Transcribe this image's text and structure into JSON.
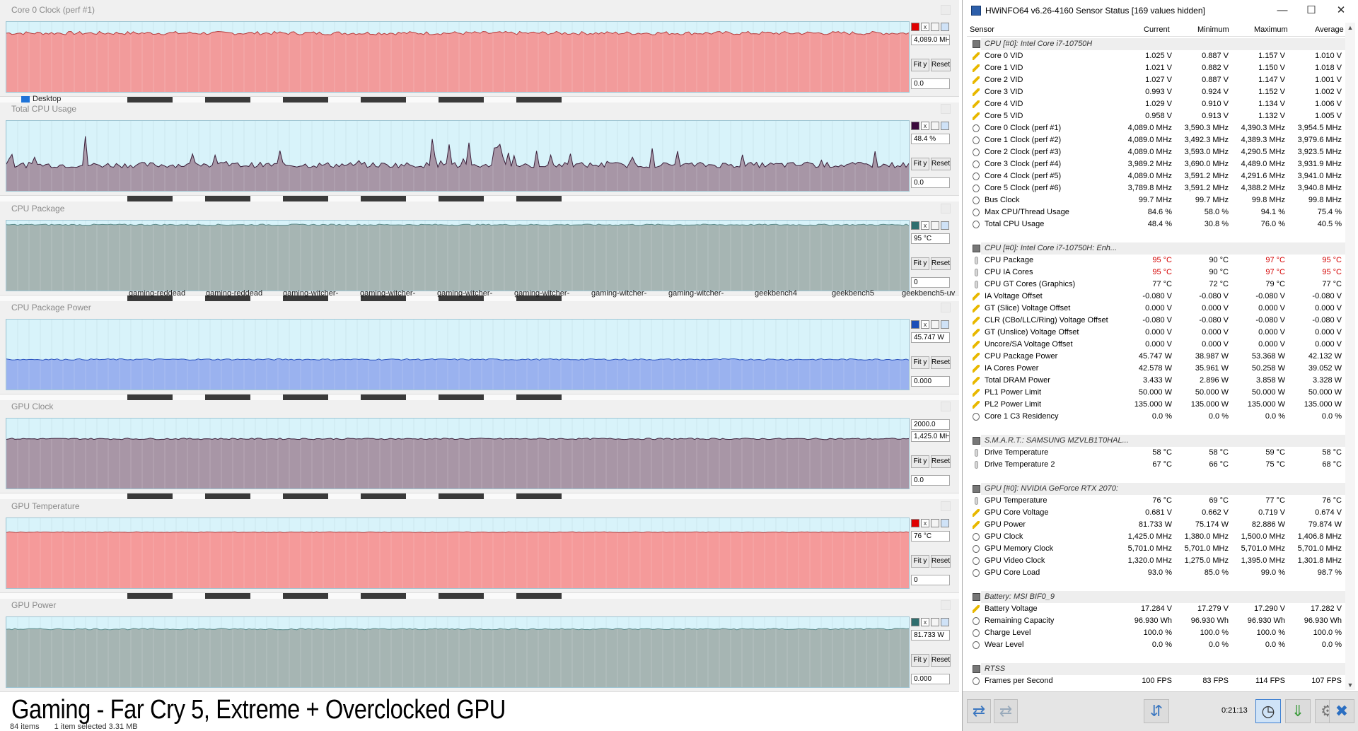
{
  "graphs": [
    {
      "title": "Core 0 Clock (perf #1)",
      "value": "4,089.0 MH:",
      "min": "0.0",
      "fit": "Fit y",
      "reset": "Reset",
      "color": "#f29b9b",
      "line": "#b63c3c",
      "level": 0.84,
      "noise": 0.025,
      "swatch": "#e00000"
    },
    {
      "title": "Total CPU Usage",
      "value": "48.4 %",
      "min": "0.0",
      "fit": "Fit y",
      "reset": "Reset",
      "color": "#a796a6",
      "line": "#3b1f3a",
      "level": 0.37,
      "noise": 0.04,
      "swatch": "#3b0a3b",
      "spiky": true
    },
    {
      "title": "CPU Package",
      "value": "95 °C",
      "min": "0",
      "fit": "Fit y",
      "reset": "Reset",
      "color": "#a6b5b3",
      "line": "#5c8c8c",
      "level": 0.94,
      "noise": 0.01,
      "swatch": "#2f6e6e"
    },
    {
      "title": "CPU Package Power",
      "value": "45.747 W",
      "min": "0.000",
      "fit": "Fit y",
      "reset": "Reset",
      "color": "#9ab2ef",
      "line": "#2d55c0",
      "level": 0.43,
      "noise": 0.01,
      "swatch": "#1d4fb8"
    },
    {
      "title": "GPU Clock",
      "value": "1,425.0 MH:",
      "max": "2000.0",
      "min": "0.0",
      "fit": "Fit y",
      "reset": "Reset",
      "color": "#a896a6",
      "line": "#3b1f3a",
      "level": 0.71,
      "noise": 0.01,
      "swatch": null
    },
    {
      "title": "GPU Temperature",
      "value": "76 °C",
      "min": "0",
      "fit": "Fit y",
      "reset": "Reset",
      "color": "#f59a9a",
      "line": "#b63c3c",
      "level": 0.8,
      "noise": 0.005,
      "swatch": "#e00000"
    },
    {
      "title": "GPU Power",
      "value": "81.733 W",
      "min": "0.000",
      "fit": "Fit y",
      "reset": "Reset",
      "color": "#a6b5b3",
      "line": "#5c8c8c",
      "level": 0.83,
      "noise": 0.01,
      "swatch": "#2f6e6e"
    }
  ],
  "desktop_label": "Desktop",
  "strip_labels": [
    "gaming-reddead",
    "gaming-reddead",
    "gaming-witcher-",
    "gaming-witcher-",
    "gaming-witcher-",
    "gaming-witcher-",
    "gaming-witcher-",
    "gaming-witcher-",
    "geekbench4",
    "geekbench5",
    "geekbench5-uv"
  ],
  "caption": "Gaming -  Far Cry 5, Extreme + Overclocked GPU",
  "statusbar": {
    "items": "84 items",
    "selected": "1 item selected  3.31 MB"
  },
  "hwinfo": {
    "title": "HWiNFO64 v6.26-4160 Sensor Status [169 values hidden]",
    "columns": [
      "Sensor",
      "Current",
      "Minimum",
      "Maximum",
      "Average"
    ],
    "timer": "0:21:13",
    "rows": [
      {
        "t": "grp",
        "n": "CPU [#0]: Intel Core i7-10750H"
      },
      {
        "t": "volt",
        "n": "Core 0 VID",
        "v": [
          "1.025 V",
          "0.887 V",
          "1.157 V",
          "1.010 V"
        ]
      },
      {
        "t": "volt",
        "n": "Core 1 VID",
        "v": [
          "1.021 V",
          "0.882 V",
          "1.150 V",
          "1.018 V"
        ]
      },
      {
        "t": "volt",
        "n": "Core 2 VID",
        "v": [
          "1.027 V",
          "0.887 V",
          "1.147 V",
          "1.001 V"
        ]
      },
      {
        "t": "volt",
        "n": "Core 3 VID",
        "v": [
          "0.993 V",
          "0.924 V",
          "1.152 V",
          "1.002 V"
        ]
      },
      {
        "t": "volt",
        "n": "Core 4 VID",
        "v": [
          "1.029 V",
          "0.910 V",
          "1.134 V",
          "1.006 V"
        ]
      },
      {
        "t": "volt",
        "n": "Core 5 VID",
        "v": [
          "0.958 V",
          "0.913 V",
          "1.132 V",
          "1.005 V"
        ]
      },
      {
        "t": "clock",
        "n": "Core 0 Clock (perf #1)",
        "v": [
          "4,089.0 MHz",
          "3,590.3 MHz",
          "4,390.3 MHz",
          "3,954.5 MHz"
        ]
      },
      {
        "t": "clock",
        "n": "Core 1 Clock (perf #2)",
        "v": [
          "4,089.0 MHz",
          "3,492.3 MHz",
          "4,389.3 MHz",
          "3,979.6 MHz"
        ]
      },
      {
        "t": "clock",
        "n": "Core 2 Clock (perf #3)",
        "v": [
          "4,089.0 MHz",
          "3,593.0 MHz",
          "4,290.5 MHz",
          "3,923.5 MHz"
        ]
      },
      {
        "t": "clock",
        "n": "Core 3 Clock (perf #4)",
        "v": [
          "3,989.2 MHz",
          "3,690.0 MHz",
          "4,489.0 MHz",
          "3,931.9 MHz"
        ]
      },
      {
        "t": "clock",
        "n": "Core 4 Clock (perf #5)",
        "v": [
          "4,089.0 MHz",
          "3,591.2 MHz",
          "4,291.6 MHz",
          "3,941.0 MHz"
        ]
      },
      {
        "t": "clock",
        "n": "Core 5 Clock (perf #6)",
        "v": [
          "3,789.8 MHz",
          "3,591.2 MHz",
          "4,388.2 MHz",
          "3,940.8 MHz"
        ]
      },
      {
        "t": "clock",
        "n": "Bus Clock",
        "v": [
          "99.7 MHz",
          "99.7 MHz",
          "99.8 MHz",
          "99.8 MHz"
        ]
      },
      {
        "t": "clock",
        "n": "Max CPU/Thread Usage",
        "v": [
          "84.6 %",
          "58.0 %",
          "94.1 %",
          "75.4 %"
        ]
      },
      {
        "t": "clock",
        "n": "Total CPU Usage",
        "v": [
          "48.4 %",
          "30.8 %",
          "76.0 %",
          "40.5 %"
        ]
      },
      {
        "t": "blank"
      },
      {
        "t": "grp",
        "n": "CPU [#0]: Intel Core i7-10750H: Enh..."
      },
      {
        "t": "temp",
        "n": "CPU Package",
        "v": [
          "95 °C",
          "90 °C",
          "97 °C",
          "95 °C"
        ],
        "red": [
          0,
          2,
          3
        ]
      },
      {
        "t": "temp",
        "n": "CPU IA Cores",
        "v": [
          "95 °C",
          "90 °C",
          "97 °C",
          "95 °C"
        ],
        "red": [
          0,
          2,
          3
        ]
      },
      {
        "t": "temp",
        "n": "CPU GT Cores (Graphics)",
        "v": [
          "77 °C",
          "72 °C",
          "79 °C",
          "77 °C"
        ]
      },
      {
        "t": "volt",
        "n": "IA Voltage Offset",
        "v": [
          "-0.080 V",
          "-0.080 V",
          "-0.080 V",
          "-0.080 V"
        ]
      },
      {
        "t": "volt",
        "n": "GT (Slice) Voltage Offset",
        "v": [
          "0.000 V",
          "0.000 V",
          "0.000 V",
          "0.000 V"
        ]
      },
      {
        "t": "volt",
        "n": "CLR (CBo/LLC/Ring) Voltage Offset",
        "v": [
          "-0.080 V",
          "-0.080 V",
          "-0.080 V",
          "-0.080 V"
        ]
      },
      {
        "t": "volt",
        "n": "GT (Unslice) Voltage Offset",
        "v": [
          "0.000 V",
          "0.000 V",
          "0.000 V",
          "0.000 V"
        ]
      },
      {
        "t": "volt",
        "n": "Uncore/SA Voltage Offset",
        "v": [
          "0.000 V",
          "0.000 V",
          "0.000 V",
          "0.000 V"
        ]
      },
      {
        "t": "volt",
        "n": "CPU Package Power",
        "v": [
          "45.747 W",
          "38.987 W",
          "53.368 W",
          "42.132 W"
        ]
      },
      {
        "t": "volt",
        "n": "IA Cores Power",
        "v": [
          "42.578 W",
          "35.961 W",
          "50.258 W",
          "39.052 W"
        ]
      },
      {
        "t": "volt",
        "n": "Total DRAM Power",
        "v": [
          "3.433 W",
          "2.896 W",
          "3.858 W",
          "3.328 W"
        ]
      },
      {
        "t": "volt",
        "n": "PL1 Power Limit",
        "v": [
          "50.000 W",
          "50.000 W",
          "50.000 W",
          "50.000 W"
        ]
      },
      {
        "t": "volt",
        "n": "PL2 Power Limit",
        "v": [
          "135.000 W",
          "135.000 W",
          "135.000 W",
          "135.000 W"
        ]
      },
      {
        "t": "clock",
        "n": "Core 1 C3 Residency",
        "v": [
          "0.0 %",
          "0.0 %",
          "0.0 %",
          "0.0 %"
        ]
      },
      {
        "t": "blank"
      },
      {
        "t": "grp",
        "n": "S.M.A.R.T.: SAMSUNG MZVLB1T0HAL..."
      },
      {
        "t": "temp",
        "n": "Drive Temperature",
        "v": [
          "58 °C",
          "58 °C",
          "59 °C",
          "58 °C"
        ]
      },
      {
        "t": "temp",
        "n": "Drive Temperature 2",
        "v": [
          "67 °C",
          "66 °C",
          "75 °C",
          "68 °C"
        ]
      },
      {
        "t": "blank"
      },
      {
        "t": "grp",
        "n": "GPU [#0]: NVIDIA GeForce RTX 2070:"
      },
      {
        "t": "temp",
        "n": "GPU Temperature",
        "v": [
          "76 °C",
          "69 °C",
          "77 °C",
          "76 °C"
        ]
      },
      {
        "t": "volt",
        "n": "GPU Core Voltage",
        "v": [
          "0.681 V",
          "0.662 V",
          "0.719 V",
          "0.674 V"
        ]
      },
      {
        "t": "volt",
        "n": "GPU Power",
        "v": [
          "81.733 W",
          "75.174 W",
          "82.886 W",
          "79.874 W"
        ]
      },
      {
        "t": "clock",
        "n": "GPU Clock",
        "v": [
          "1,425.0 MHz",
          "1,380.0 MHz",
          "1,500.0 MHz",
          "1,406.8 MHz"
        ]
      },
      {
        "t": "clock",
        "n": "GPU Memory Clock",
        "v": [
          "5,701.0 MHz",
          "5,701.0 MHz",
          "5,701.0 MHz",
          "5,701.0 MHz"
        ]
      },
      {
        "t": "clock",
        "n": "GPU Video Clock",
        "v": [
          "1,320.0 MHz",
          "1,275.0 MHz",
          "1,395.0 MHz",
          "1,301.8 MHz"
        ]
      },
      {
        "t": "clock",
        "n": "GPU Core Load",
        "v": [
          "93.0 %",
          "85.0 %",
          "99.0 %",
          "98.7 %"
        ]
      },
      {
        "t": "blank"
      },
      {
        "t": "grp",
        "n": "Battery: MSI BIF0_9"
      },
      {
        "t": "volt",
        "n": "Battery Voltage",
        "v": [
          "17.284 V",
          "17.279 V",
          "17.290 V",
          "17.282 V"
        ]
      },
      {
        "t": "clock",
        "n": "Remaining Capacity",
        "v": [
          "96.930 Wh",
          "96.930 Wh",
          "96.930 Wh",
          "96.930 Wh"
        ]
      },
      {
        "t": "clock",
        "n": "Charge Level",
        "v": [
          "100.0 %",
          "100.0 %",
          "100.0 %",
          "100.0 %"
        ]
      },
      {
        "t": "clock",
        "n": "Wear Level",
        "v": [
          "0.0 %",
          "0.0 %",
          "0.0 %",
          "0.0 %"
        ]
      },
      {
        "t": "blank"
      },
      {
        "t": "grp",
        "n": "RTSS"
      },
      {
        "t": "clock",
        "n": "Frames per Second",
        "v": [
          "100 FPS",
          "83 FPS",
          "114 FPS",
          "107 FPS"
        ]
      }
    ]
  }
}
